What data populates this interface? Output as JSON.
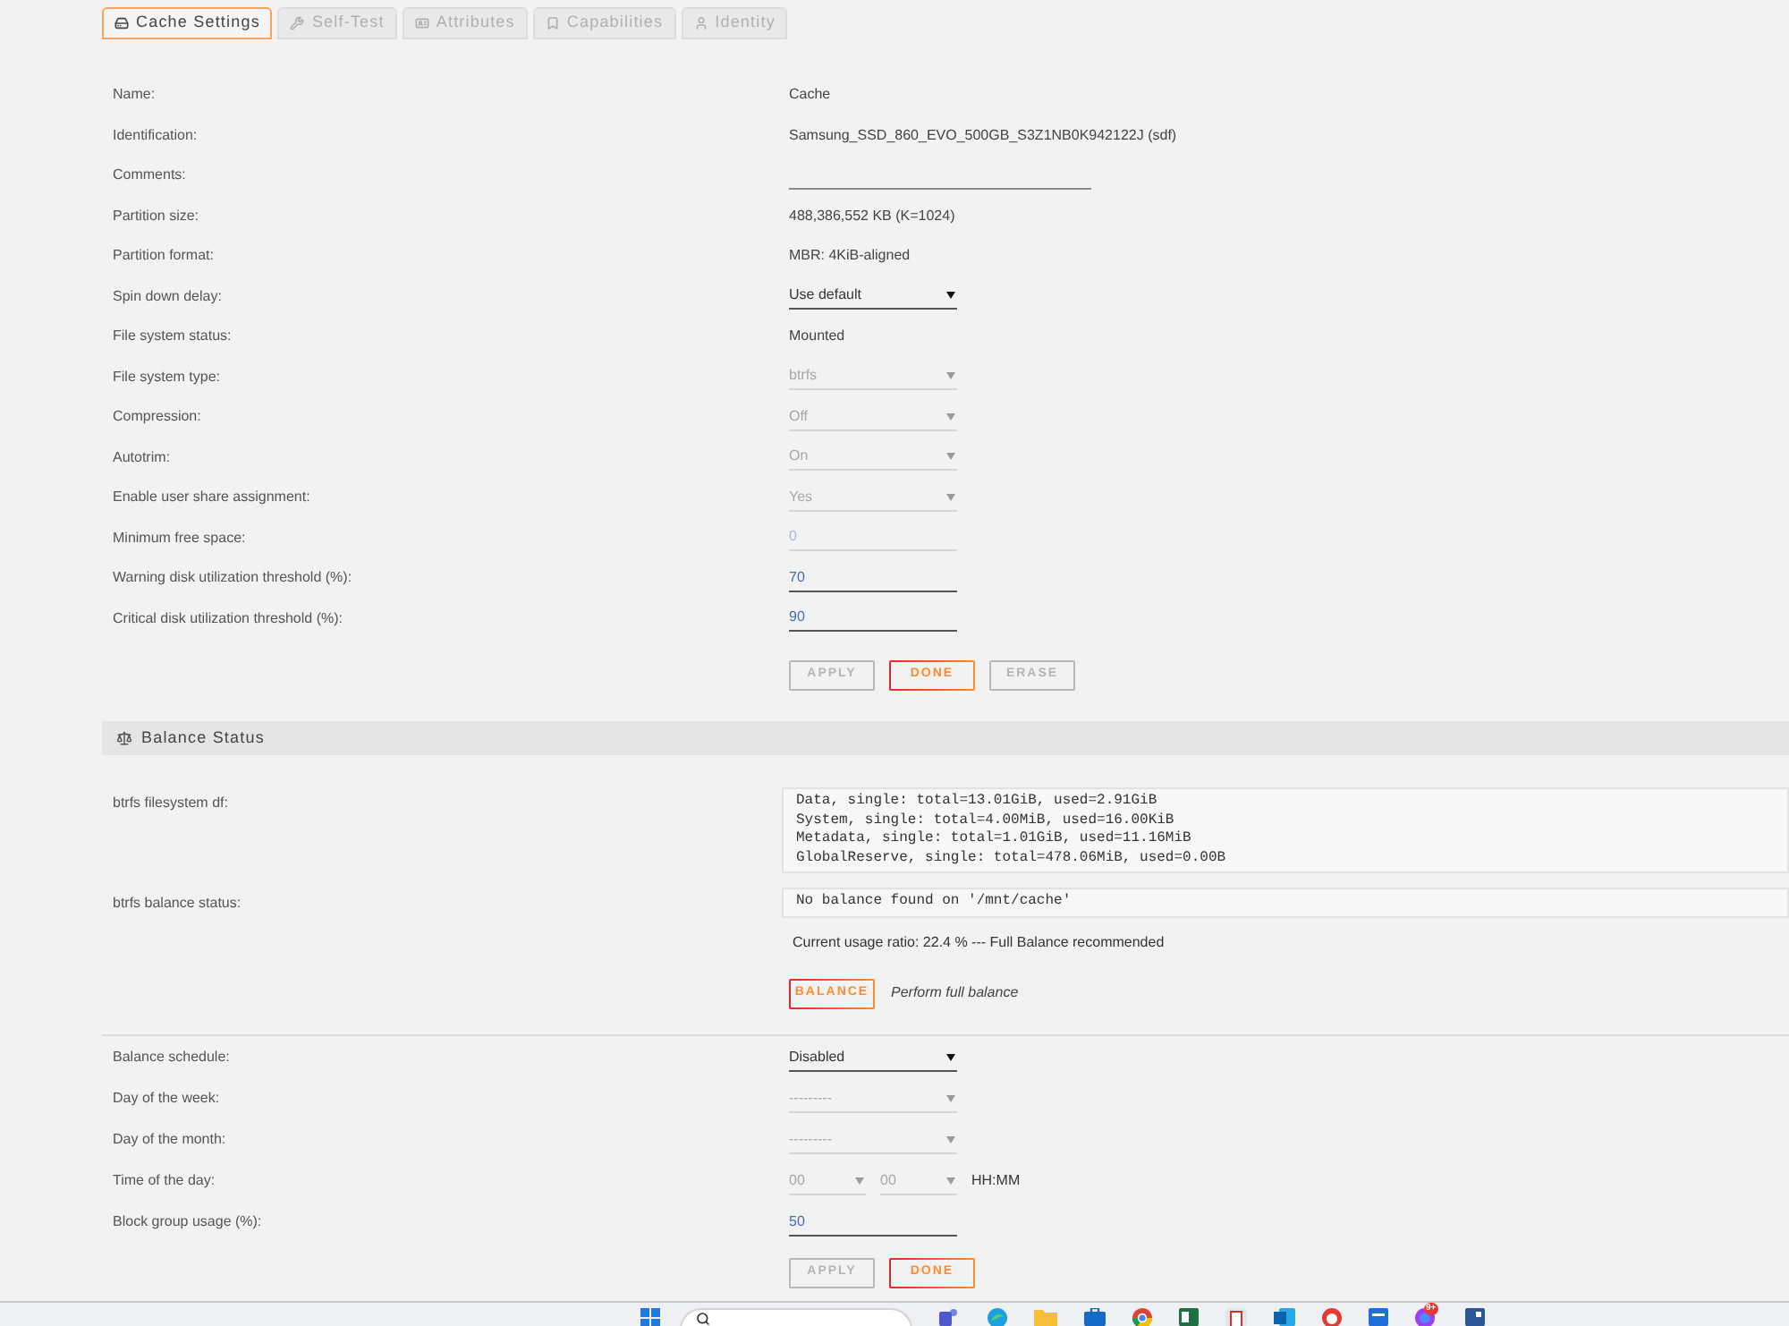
{
  "tabs": [
    {
      "label": "Cache Settings",
      "selected": true
    },
    {
      "label": "Self-Test",
      "selected": false
    },
    {
      "label": "Attributes",
      "selected": false
    },
    {
      "label": "Capabilities",
      "selected": false
    },
    {
      "label": "Identity",
      "selected": false
    }
  ],
  "settings": {
    "rows": [
      {
        "label": "Name:",
        "kind": "static",
        "value": "Cache"
      },
      {
        "label": "Identification:",
        "kind": "static",
        "value": "Samsung_SSD_860_EVO_500GB_S3Z1NB0K942122J (sdf)"
      },
      {
        "label": "Comments:",
        "kind": "text_input",
        "disabled": false
      },
      {
        "label": "Partition size:",
        "kind": "static",
        "value": "488,386,552 KB (K=1024)"
      },
      {
        "label": "Partition format:",
        "kind": "static",
        "value": "MBR: 4KiB-aligned"
      },
      {
        "label": "Spin down delay:",
        "kind": "select",
        "value": "Use default",
        "disabled": false
      },
      {
        "label": "File system status:",
        "kind": "static",
        "value": "Mounted"
      },
      {
        "label": "File system type:",
        "kind": "select",
        "value": "btrfs",
        "disabled": true
      },
      {
        "label": "Compression:",
        "kind": "select",
        "value": "Off",
        "disabled": true
      },
      {
        "label": "Autotrim:",
        "kind": "select",
        "value": "On",
        "disabled": true
      },
      {
        "label": "Enable user share assignment:",
        "kind": "select",
        "value": "Yes",
        "disabled": true
      },
      {
        "label": "Minimum free space:",
        "kind": "number_input",
        "value": "0",
        "disabled": true
      },
      {
        "label": "Warning disk utilization threshold (%):",
        "kind": "number_input",
        "value": "70",
        "disabled": false
      },
      {
        "label": "Critical disk utilization threshold (%):",
        "kind": "number_input",
        "value": "90",
        "disabled": false
      }
    ],
    "buttons": [
      {
        "label": "APPLY",
        "disabled": true
      },
      {
        "label": "DONE",
        "disabled": false
      },
      {
        "label": "ERASE",
        "disabled": true
      }
    ]
  },
  "balance_status": {
    "title": "Balance Status",
    "outputs": [
      {
        "label": "btrfs filesystem df:",
        "lines": [
          "Data, single: total=13.01GiB, used=2.91GiB",
          "System, single: total=4.00MiB, used=16.00KiB",
          "Metadata, single: total=1.01GiB, used=11.16MiB",
          "GlobalReserve, single: total=478.06MiB, used=0.00B"
        ]
      },
      {
        "label": "btrfs balance status:",
        "lines": [
          "No balance found on '/mnt/cache'"
        ]
      }
    ],
    "usage_note": "Current usage ratio: 22.4 % --- Full Balance recommended",
    "action": {
      "button": {
        "label": "BALANCE",
        "disabled": false
      },
      "hint": "Perform full balance"
    }
  },
  "schedule": {
    "rows": [
      {
        "label": "Balance schedule:",
        "kind": "select",
        "value": "Disabled",
        "disabled": false
      },
      {
        "label": "Day of the week:",
        "kind": "select",
        "value": "---------",
        "disabled": true
      },
      {
        "label": "Day of the month:",
        "kind": "select",
        "value": "---------",
        "disabled": true
      },
      {
        "label": "Time of the day:",
        "kind": "time",
        "fields": [
          {
            "value": "00",
            "disabled": true
          },
          {
            "value": "00",
            "disabled": true
          }
        ],
        "unit": "HH:MM"
      },
      {
        "label": "Block group usage (%):",
        "kind": "number_input",
        "value": "50",
        "disabled": false
      }
    ],
    "buttons": [
      {
        "label": "APPLY",
        "disabled": true
      },
      {
        "label": "DONE",
        "disabled": false
      }
    ]
  },
  "taskbar": {
    "badge": "9+"
  }
}
